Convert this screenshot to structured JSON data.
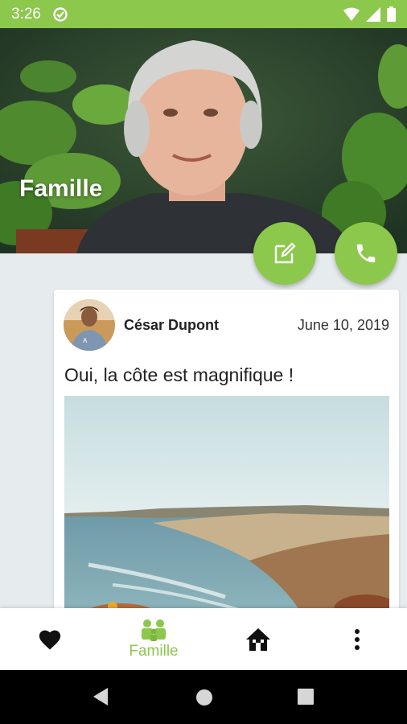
{
  "status_bar": {
    "time": "3:26",
    "background": "#8cc84b",
    "icons": [
      "sync-icon",
      "wifi-icon",
      "signal-icon",
      "battery-icon"
    ]
  },
  "header": {
    "title": "Famille"
  },
  "fabs": {
    "edit_icon": "edit-icon",
    "call_icon": "phone-icon"
  },
  "post": {
    "author": "César Dupont",
    "date": "June 10, 2019",
    "text": "Oui, la côte est magnifique !"
  },
  "bottom_nav": {
    "items": [
      {
        "icon": "heart-icon",
        "label": ""
      },
      {
        "icon": "family-icon",
        "label": "Famille",
        "active": true
      },
      {
        "icon": "home-icon",
        "label": ""
      },
      {
        "icon": "more-vert-icon",
        "label": ""
      }
    ],
    "accent": "#8cc84b"
  },
  "system_nav": {
    "icons": [
      "back-icon",
      "home-circle-icon",
      "recents-icon"
    ]
  }
}
